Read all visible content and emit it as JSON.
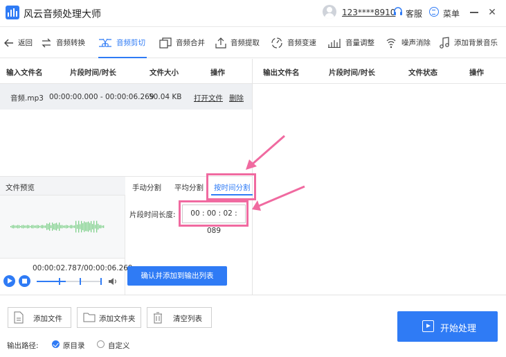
{
  "app": {
    "title": "风云音频处理大师"
  },
  "account": {
    "user": "123****8910",
    "service_label": "客服",
    "menu_label": "菜单"
  },
  "toolbar": {
    "back": "返回",
    "items": [
      "音频转换",
      "音频剪切",
      "音频合并",
      "音频提取",
      "音频变速",
      "音量调整",
      "噪声消除",
      "添加背景音乐"
    ],
    "active_index": 1
  },
  "input_table": {
    "headers": [
      "输入文件名",
      "片段时间/时长",
      "文件大小",
      "操作"
    ],
    "rows": [
      {
        "name": "音频.mp3",
        "range": "00:00:00.000 - 00:00:06.269",
        "size": "50.04 KB",
        "open": "打开文件",
        "delete": "删除"
      }
    ]
  },
  "output_table": {
    "headers": [
      "输出文件名",
      "片段时间/时长",
      "文件状态",
      "操作"
    ]
  },
  "preview": {
    "title": "文件预览",
    "time": "00:00:02.787/00:00:06.269",
    "progress": 0.445
  },
  "split": {
    "tabs": [
      "手动分割",
      "平均分割",
      "按时间分割"
    ],
    "active_tab": 2,
    "length_label": "片段时间长度:",
    "length_value": "00 : 00 : 02 : 089",
    "confirm": "确认并添加到输出列表"
  },
  "bottom": {
    "add_file": "添加文件",
    "add_folder": "添加文件夹",
    "clear": "清空列表",
    "start": "开始处理",
    "output_path_label": "输出路径:",
    "opt_original": "原目录",
    "opt_custom": "自定义"
  },
  "colors": {
    "accent": "#2f7bf5",
    "highlight": "#f06aa0",
    "waveform": "#7fd08a"
  }
}
